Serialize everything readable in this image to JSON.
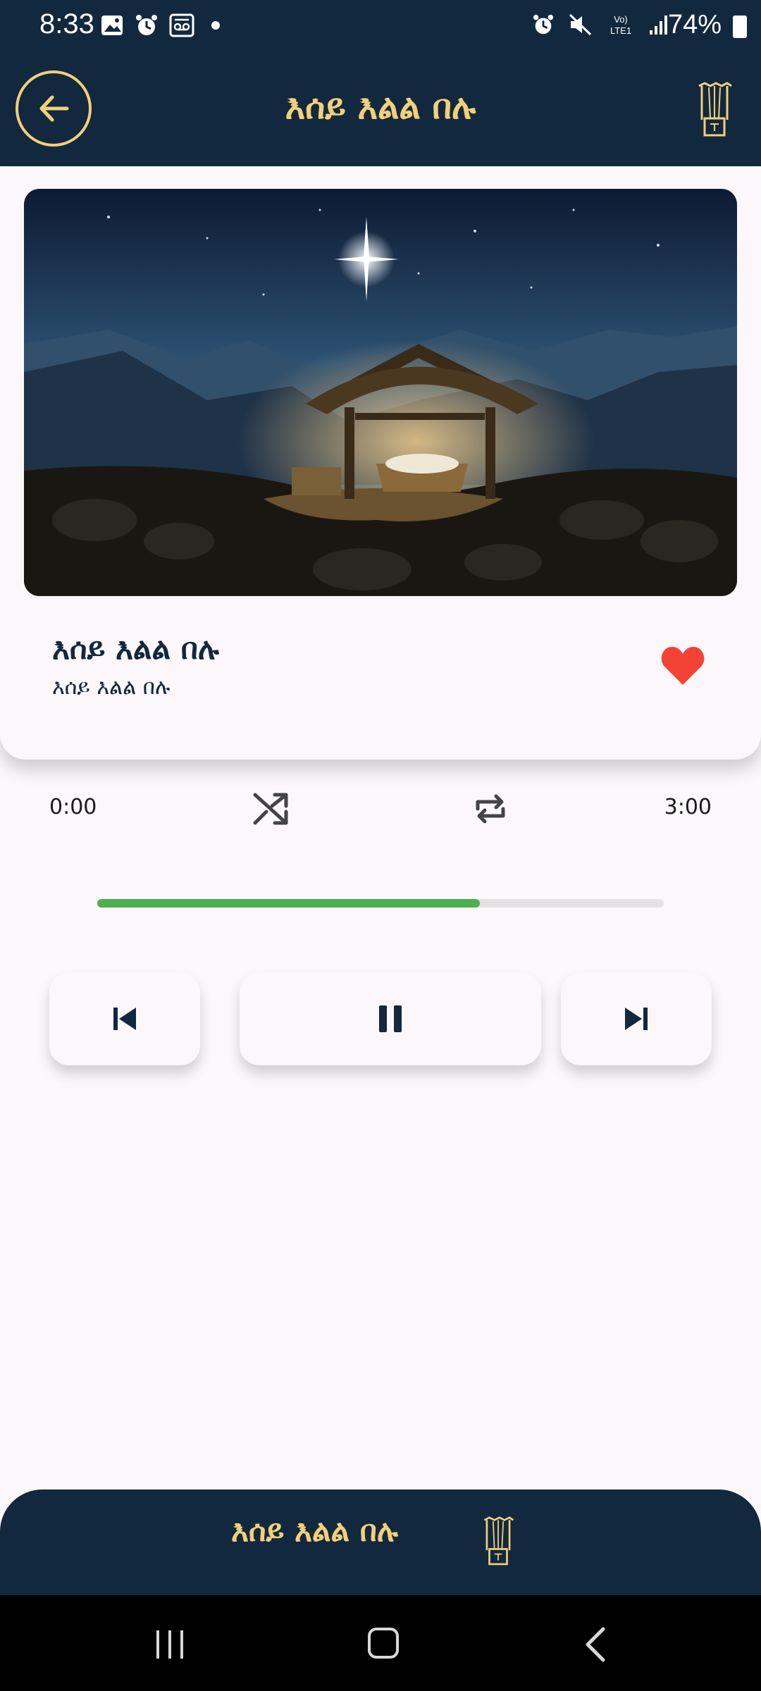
{
  "status_bar": {
    "time": "8:33",
    "battery": "74%",
    "network_label_top": "Vo)",
    "network_label_bottom": "LTE1"
  },
  "app_bar": {
    "title": "እሰይ እልል በሉ",
    "back_icon": "arrow-left-icon",
    "logo_icon": "harp-icon"
  },
  "now_playing": {
    "title": "እሰይ እልል በሉ",
    "subtitle": "እሰይ እልል በሉ",
    "favorite": true,
    "favorite_color": "#f44336",
    "artwork": "nativity-manger-under-star"
  },
  "player": {
    "current_time": "0:00",
    "total_time": "3:00",
    "progress": 0.675,
    "shuffle_icon": "shuffle-icon",
    "repeat_icon": "repeat-icon",
    "prev_icon": "skip-previous-icon",
    "play_icon": "pause-icon",
    "next_icon": "skip-next-icon",
    "accent_color": "#4caf50"
  },
  "mini_player": {
    "title": "እሰይ እልል በሉ",
    "logo_icon": "harp-icon"
  },
  "theme": {
    "primary": "#12283f",
    "gold": "#f2d07a",
    "background": "#fbf7fb"
  }
}
